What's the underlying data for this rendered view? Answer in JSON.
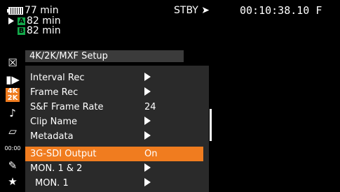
{
  "status": {
    "battery_time": "77 min",
    "slot_a_letter": "A",
    "slot_a_time": "82 min",
    "slot_b_letter": "B",
    "slot_b_time": "82 min",
    "record_state": "STBY",
    "timecode": "00:10:38.10 F"
  },
  "side_icons": [
    {
      "name": "close-icon",
      "glyph": "☒"
    },
    {
      "name": "camera-icon",
      "glyph": "▮▶"
    },
    {
      "name": "4k2k-icon",
      "glyph": "4K\n2K"
    },
    {
      "name": "audio-icon",
      "glyph": "♪"
    },
    {
      "name": "display-icon",
      "glyph": "▱"
    },
    {
      "name": "tc-icon",
      "glyph": "00:00"
    },
    {
      "name": "wrench-icon",
      "glyph": "✎"
    },
    {
      "name": "star-icon",
      "glyph": "★"
    }
  ],
  "menu": {
    "title": "4K/2K/MXF Setup",
    "items": [
      {
        "label": "Interval Rec",
        "value": "",
        "arrow": true
      },
      {
        "label": "Frame Rec",
        "value": "",
        "arrow": true
      },
      {
        "label": "S&F Frame Rate",
        "value": "24",
        "arrow": false
      },
      {
        "label": "Clip Name",
        "value": "",
        "arrow": true
      },
      {
        "label": "Metadata",
        "value": "",
        "arrow": true
      },
      {
        "label": "3G-SDI Output",
        "value": "On",
        "arrow": false
      },
      {
        "label": "MON. 1 & 2",
        "value": "",
        "arrow": true
      },
      {
        "label": "MON. 1",
        "value": "",
        "arrow": true
      }
    ]
  },
  "colors": {
    "highlight": "#f07c1f",
    "slot": "#13a84a"
  }
}
